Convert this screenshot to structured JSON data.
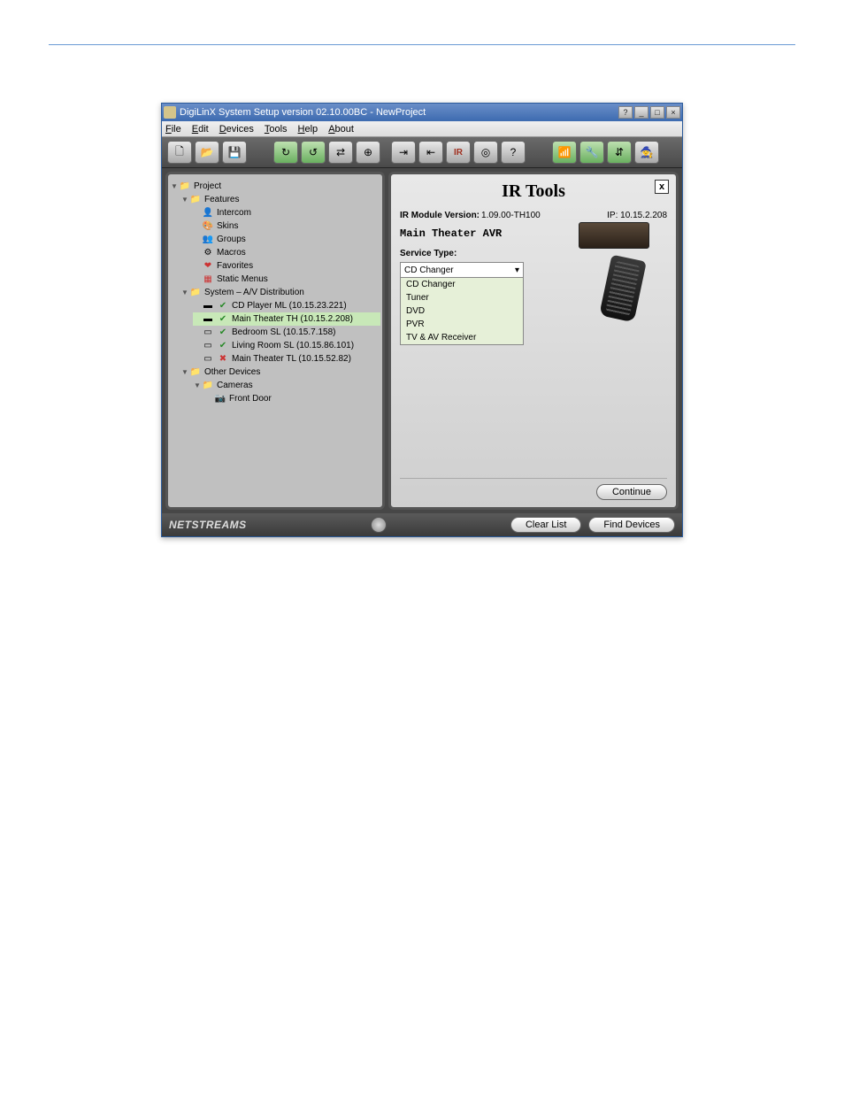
{
  "window": {
    "title": "DigiLinX System Setup version 02.10.00BC - NewProject",
    "help_btn": "?",
    "min_btn": "_",
    "max_btn": "□",
    "close_btn": "×"
  },
  "menu": [
    "File",
    "Edit",
    "Devices",
    "Tools",
    "Help",
    "About"
  ],
  "toolbar_icons": {
    "new": "🗋",
    "open": "📂",
    "save": "💾",
    "g1": "↻",
    "g2": "↺",
    "g3": "⇄",
    "g4": "⊕",
    "arrow_in": "⇥",
    "arrow_out": "⇤",
    "ir": "IR",
    "target": "◎",
    "q": "?",
    "end1": "📶",
    "end2": "🔧",
    "end3": "⇵",
    "end4": "🧙"
  },
  "tree": {
    "root": "Project",
    "features": {
      "label": "Features",
      "items": [
        "Intercom",
        "Skins",
        "Groups",
        "Macros",
        "Favorites",
        "Static Menus"
      ]
    },
    "system": {
      "label": "System – A/V Distribution",
      "items": [
        "CD Player ML (10.15.23.221)",
        "Main Theater TH (10.15.2.208)",
        "Bedroom SL (10.15.7.158)",
        "Living Room SL (10.15.86.101)",
        "Main Theater TL (10.15.52.82)"
      ],
      "selected_index": 1
    },
    "other": {
      "label": "Other Devices",
      "cameras": {
        "label": "Cameras",
        "items": [
          "Front Door"
        ]
      }
    }
  },
  "panel": {
    "title": "IR Tools",
    "close": "x",
    "module_label": "IR Module Version:",
    "module_value": "1.09.00-TH100",
    "ip_label": "IP:",
    "ip_value": "10.15.2.208",
    "device_name": "Main Theater AVR",
    "service_label": "Service Type:",
    "service_selected": "CD Changer",
    "service_options": [
      "CD Changer",
      "Tuner",
      "DVD",
      "PVR",
      "TV & AV Receiver"
    ],
    "continue_btn": "Continue"
  },
  "status": {
    "brand": "NETSTREAMS",
    "clear_btn": "Clear List",
    "find_btn": "Find Devices"
  }
}
